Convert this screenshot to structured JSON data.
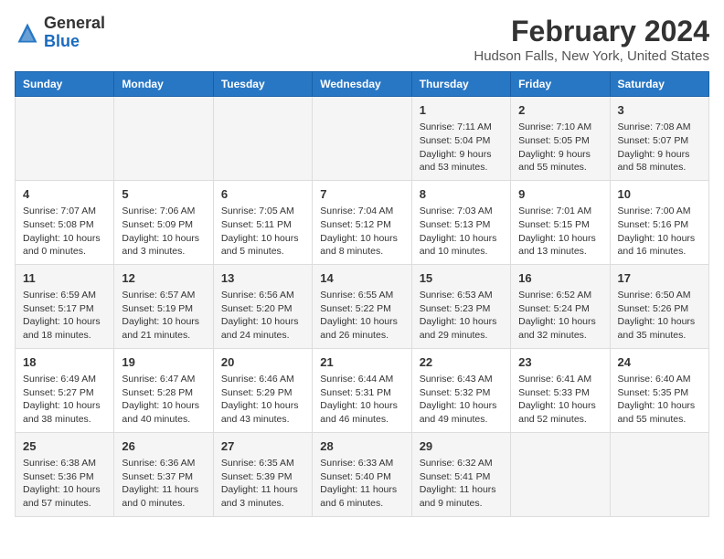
{
  "header": {
    "logo_general": "General",
    "logo_blue": "Blue",
    "main_title": "February 2024",
    "sub_title": "Hudson Falls, New York, United States"
  },
  "days_of_week": [
    "Sunday",
    "Monday",
    "Tuesday",
    "Wednesday",
    "Thursday",
    "Friday",
    "Saturday"
  ],
  "weeks": [
    [
      {
        "day": "",
        "info": ""
      },
      {
        "day": "",
        "info": ""
      },
      {
        "day": "",
        "info": ""
      },
      {
        "day": "",
        "info": ""
      },
      {
        "day": "1",
        "info": "Sunrise: 7:11 AM\nSunset: 5:04 PM\nDaylight: 9 hours\nand 53 minutes."
      },
      {
        "day": "2",
        "info": "Sunrise: 7:10 AM\nSunset: 5:05 PM\nDaylight: 9 hours\nand 55 minutes."
      },
      {
        "day": "3",
        "info": "Sunrise: 7:08 AM\nSunset: 5:07 PM\nDaylight: 9 hours\nand 58 minutes."
      }
    ],
    [
      {
        "day": "4",
        "info": "Sunrise: 7:07 AM\nSunset: 5:08 PM\nDaylight: 10 hours\nand 0 minutes."
      },
      {
        "day": "5",
        "info": "Sunrise: 7:06 AM\nSunset: 5:09 PM\nDaylight: 10 hours\nand 3 minutes."
      },
      {
        "day": "6",
        "info": "Sunrise: 7:05 AM\nSunset: 5:11 PM\nDaylight: 10 hours\nand 5 minutes."
      },
      {
        "day": "7",
        "info": "Sunrise: 7:04 AM\nSunset: 5:12 PM\nDaylight: 10 hours\nand 8 minutes."
      },
      {
        "day": "8",
        "info": "Sunrise: 7:03 AM\nSunset: 5:13 PM\nDaylight: 10 hours\nand 10 minutes."
      },
      {
        "day": "9",
        "info": "Sunrise: 7:01 AM\nSunset: 5:15 PM\nDaylight: 10 hours\nand 13 minutes."
      },
      {
        "day": "10",
        "info": "Sunrise: 7:00 AM\nSunset: 5:16 PM\nDaylight: 10 hours\nand 16 minutes."
      }
    ],
    [
      {
        "day": "11",
        "info": "Sunrise: 6:59 AM\nSunset: 5:17 PM\nDaylight: 10 hours\nand 18 minutes."
      },
      {
        "day": "12",
        "info": "Sunrise: 6:57 AM\nSunset: 5:19 PM\nDaylight: 10 hours\nand 21 minutes."
      },
      {
        "day": "13",
        "info": "Sunrise: 6:56 AM\nSunset: 5:20 PM\nDaylight: 10 hours\nand 24 minutes."
      },
      {
        "day": "14",
        "info": "Sunrise: 6:55 AM\nSunset: 5:22 PM\nDaylight: 10 hours\nand 26 minutes."
      },
      {
        "day": "15",
        "info": "Sunrise: 6:53 AM\nSunset: 5:23 PM\nDaylight: 10 hours\nand 29 minutes."
      },
      {
        "day": "16",
        "info": "Sunrise: 6:52 AM\nSunset: 5:24 PM\nDaylight: 10 hours\nand 32 minutes."
      },
      {
        "day": "17",
        "info": "Sunrise: 6:50 AM\nSunset: 5:26 PM\nDaylight: 10 hours\nand 35 minutes."
      }
    ],
    [
      {
        "day": "18",
        "info": "Sunrise: 6:49 AM\nSunset: 5:27 PM\nDaylight: 10 hours\nand 38 minutes."
      },
      {
        "day": "19",
        "info": "Sunrise: 6:47 AM\nSunset: 5:28 PM\nDaylight: 10 hours\nand 40 minutes."
      },
      {
        "day": "20",
        "info": "Sunrise: 6:46 AM\nSunset: 5:29 PM\nDaylight: 10 hours\nand 43 minutes."
      },
      {
        "day": "21",
        "info": "Sunrise: 6:44 AM\nSunset: 5:31 PM\nDaylight: 10 hours\nand 46 minutes."
      },
      {
        "day": "22",
        "info": "Sunrise: 6:43 AM\nSunset: 5:32 PM\nDaylight: 10 hours\nand 49 minutes."
      },
      {
        "day": "23",
        "info": "Sunrise: 6:41 AM\nSunset: 5:33 PM\nDaylight: 10 hours\nand 52 minutes."
      },
      {
        "day": "24",
        "info": "Sunrise: 6:40 AM\nSunset: 5:35 PM\nDaylight: 10 hours\nand 55 minutes."
      }
    ],
    [
      {
        "day": "25",
        "info": "Sunrise: 6:38 AM\nSunset: 5:36 PM\nDaylight: 10 hours\nand 57 minutes."
      },
      {
        "day": "26",
        "info": "Sunrise: 6:36 AM\nSunset: 5:37 PM\nDaylight: 11 hours\nand 0 minutes."
      },
      {
        "day": "27",
        "info": "Sunrise: 6:35 AM\nSunset: 5:39 PM\nDaylight: 11 hours\nand 3 minutes."
      },
      {
        "day": "28",
        "info": "Sunrise: 6:33 AM\nSunset: 5:40 PM\nDaylight: 11 hours\nand 6 minutes."
      },
      {
        "day": "29",
        "info": "Sunrise: 6:32 AM\nSunset: 5:41 PM\nDaylight: 11 hours\nand 9 minutes."
      },
      {
        "day": "",
        "info": ""
      },
      {
        "day": "",
        "info": ""
      }
    ]
  ]
}
